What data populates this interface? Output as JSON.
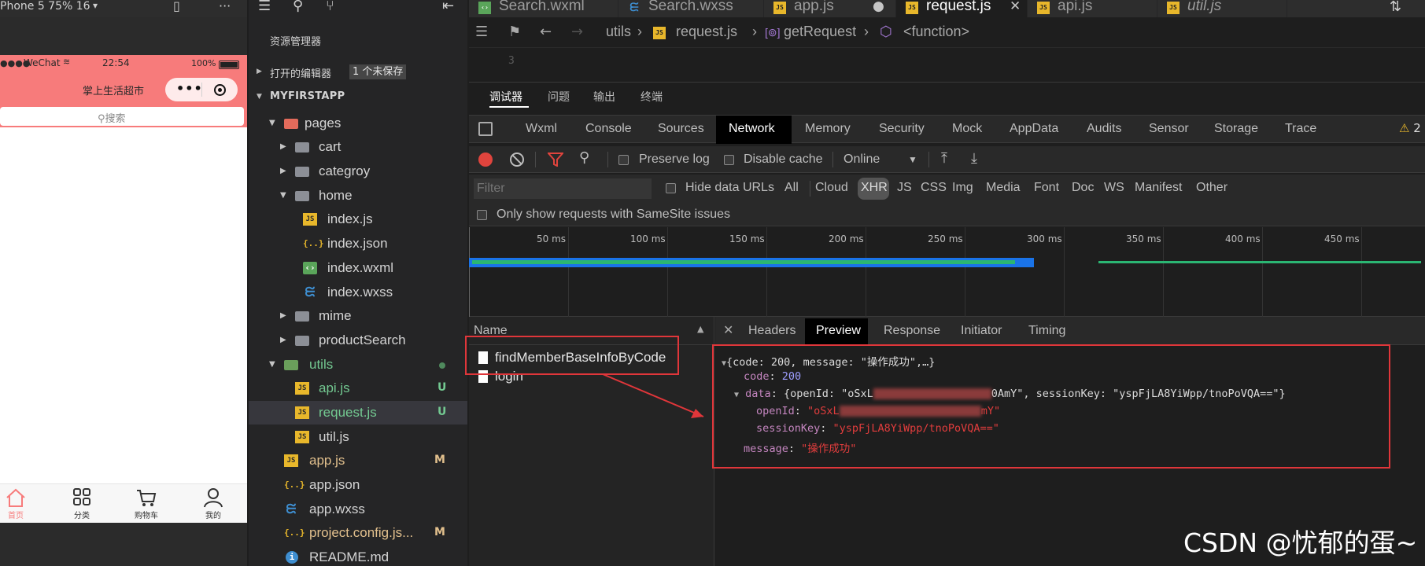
{
  "simulator": {
    "device_label": "Phone 5 75% 16",
    "status": {
      "carrier": "WeChat",
      "time": "22:54",
      "battery": "100%"
    },
    "nav_title": "掌上生活超市",
    "search_placeholder": "搜索",
    "tabbar": [
      {
        "label": "首页",
        "icon": "home-icon"
      },
      {
        "label": "分类",
        "icon": "grid-icon"
      },
      {
        "label": "购物车",
        "icon": "cart-icon"
      },
      {
        "label": "我的",
        "icon": "user-icon"
      }
    ],
    "colors": {
      "nav": "#f77b7b",
      "active_tab": "#f77b7b"
    }
  },
  "explorer": {
    "title": "资源管理器",
    "open_editors": "打开的编辑器",
    "unsaved_badge": "1 个未保存",
    "project": "MYFIRSTAPP",
    "tree": [
      {
        "name": "pages",
        "icon": "folder-red-icon"
      },
      {
        "name": "cart",
        "icon": "folder-icon"
      },
      {
        "name": "categroy",
        "icon": "folder-icon"
      },
      {
        "name": "home",
        "icon": "folder-open-icon"
      },
      {
        "name": "index.js",
        "icon": "js-icon"
      },
      {
        "name": "index.json",
        "icon": "json-icon"
      },
      {
        "name": "index.wxml",
        "icon": "wxml-icon"
      },
      {
        "name": "index.wxss",
        "icon": "css-icon"
      },
      {
        "name": "mime",
        "icon": "folder-icon"
      },
      {
        "name": "productSearch",
        "icon": "folder-icon"
      },
      {
        "name": "utils",
        "icon": "folder-green-icon"
      },
      {
        "name": "api.js",
        "icon": "js-icon",
        "git": "U"
      },
      {
        "name": "request.js",
        "icon": "js-icon",
        "git": "U"
      },
      {
        "name": "util.js",
        "icon": "js-icon"
      },
      {
        "name": "app.js",
        "icon": "js-icon",
        "git": "M"
      },
      {
        "name": "app.json",
        "icon": "json-icon"
      },
      {
        "name": "app.wxss",
        "icon": "css-icon"
      },
      {
        "name": "project.config.js...",
        "icon": "json-icon",
        "git": "M"
      },
      {
        "name": "README.md",
        "icon": "info-icon"
      }
    ]
  },
  "editor": {
    "tabs": [
      {
        "label": "Search.wxml",
        "icon": "wxml-icon"
      },
      {
        "label": "Search.wxss",
        "icon": "css-icon"
      },
      {
        "label": "app.js",
        "icon": "js-icon"
      },
      {
        "label": "request.js",
        "icon": "js-icon"
      },
      {
        "label": "api.js",
        "icon": "js-icon"
      },
      {
        "label": "util.js",
        "icon": "js-icon"
      }
    ],
    "breadcrumb": [
      "utils",
      "request.js",
      "getRequest",
      "<function>"
    ],
    "line_number": "3"
  },
  "debugger": {
    "panel_tabs": [
      "调试器",
      "问题",
      "输出",
      "终端"
    ],
    "devtools_tabs": [
      "Wxml",
      "Console",
      "Sources",
      "Network",
      "Memory",
      "Security",
      "Mock",
      "AppData",
      "Audits",
      "Sensor",
      "Storage",
      "Trace"
    ],
    "warning_count": "2",
    "toolbar": {
      "preserve_log": "Preserve log",
      "disable_cache": "Disable cache",
      "throttle": "Online"
    },
    "filter_placeholder": "Filter",
    "hide_data_urls": "Hide data URLs",
    "types": [
      "All",
      "Cloud",
      "XHR",
      "JS",
      "CSS",
      "Img",
      "Media",
      "Font",
      "Doc",
      "WS",
      "Manifest",
      "Other"
    ],
    "samesite": "Only show requests with SameSite issues",
    "timeline_ticks": [
      "50 ms",
      "100 ms",
      "150 ms",
      "200 ms",
      "250 ms",
      "300 ms",
      "350 ms",
      "400 ms",
      "450 ms"
    ],
    "name_header": "Name",
    "requests": [
      "findMemberBaseInfoByCode",
      "login"
    ],
    "detail_tabs": [
      "Headers",
      "Preview",
      "Response",
      "Initiator",
      "Timing"
    ],
    "preview": {
      "summary": "{code: 200, message: \"操作成功\",…}",
      "code_key": "code",
      "code_val": "200",
      "data_key": "data",
      "data_summary_a": "{openId: \"oSxL",
      "data_summary_b": "0AmY\", sessionKey: \"yspFjLA8YiWpp/tnoPoVQA==\"}",
      "openid_key": "openId",
      "openid_a": "\"oSxL",
      "openid_b": "mY\"",
      "sessionkey_key": "sessionKey",
      "sessionkey_val": "\"yspFjLA8YiWpp/tnoPoVQA==\"",
      "message_key": "message",
      "message_val": "\"操作成功\""
    }
  },
  "watermark": "CSDN @忧郁的蛋~"
}
